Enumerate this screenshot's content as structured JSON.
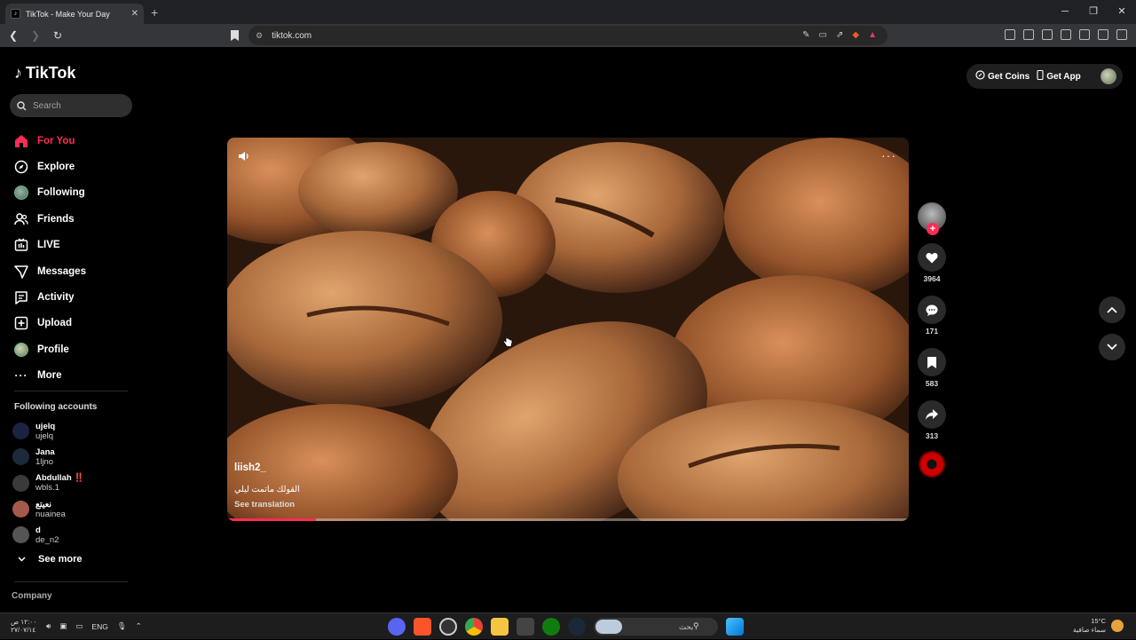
{
  "browser": {
    "tab_title": "TikTok - Make Your Day",
    "tab_close": "✕",
    "new_tab": "+",
    "url": "tiktok.com",
    "window_controls": [
      "─",
      "❐",
      "✕"
    ]
  },
  "tiktok": {
    "logo": "TikTok",
    "search_placeholder": "Search",
    "nav": [
      {
        "label": "For You",
        "icon": "home-icon",
        "active": true
      },
      {
        "label": "Explore",
        "icon": "compass-icon"
      },
      {
        "label": "Following",
        "icon": "following-avatar-icon"
      },
      {
        "label": "Friends",
        "icon": "friends-icon"
      },
      {
        "label": "LIVE",
        "icon": "live-icon"
      },
      {
        "label": "Messages",
        "icon": "messages-icon"
      },
      {
        "label": "Activity",
        "icon": "activity-icon"
      },
      {
        "label": "Upload",
        "icon": "upload-icon"
      },
      {
        "label": "Profile",
        "icon": "profile-avatar-icon"
      },
      {
        "label": "More",
        "icon": "more-icon"
      }
    ],
    "following_accounts_title": "Following accounts",
    "following_accounts": [
      {
        "name": "ujelq",
        "handle": "ujelq",
        "color": "#1a2340"
      },
      {
        "name": "Jana",
        "handle": "1ljno",
        "color": "#1c2a3c"
      },
      {
        "name": "Abdullah ‼️",
        "handle": "wbls.1",
        "color": "#3a3a3a"
      },
      {
        "name": "نعيتع",
        "handle": "nuainea",
        "color": "#a45a4a"
      },
      {
        "name": "d",
        "handle": "de_n2",
        "color": "#555555"
      }
    ],
    "see_more": "See more",
    "company": "Company",
    "get_coins": "Get Coins",
    "get_app": "Get App"
  },
  "video": {
    "author": "liish2_",
    "caption": "القولك ماتمت ليلي",
    "see_translation": "See translation",
    "more": "···",
    "progress": 0.13
  },
  "actions": {
    "likes": "3964",
    "comments": "171",
    "saves": "583",
    "shares": "313",
    "follow_plus": "+"
  },
  "taskbar": {
    "time": "١٢:٠٠ ص",
    "date": "٢٧/٠٧/١٤",
    "lang": "ENG",
    "search_text": "بحث",
    "temperature": "15°C",
    "weather": "سماء صافية"
  }
}
